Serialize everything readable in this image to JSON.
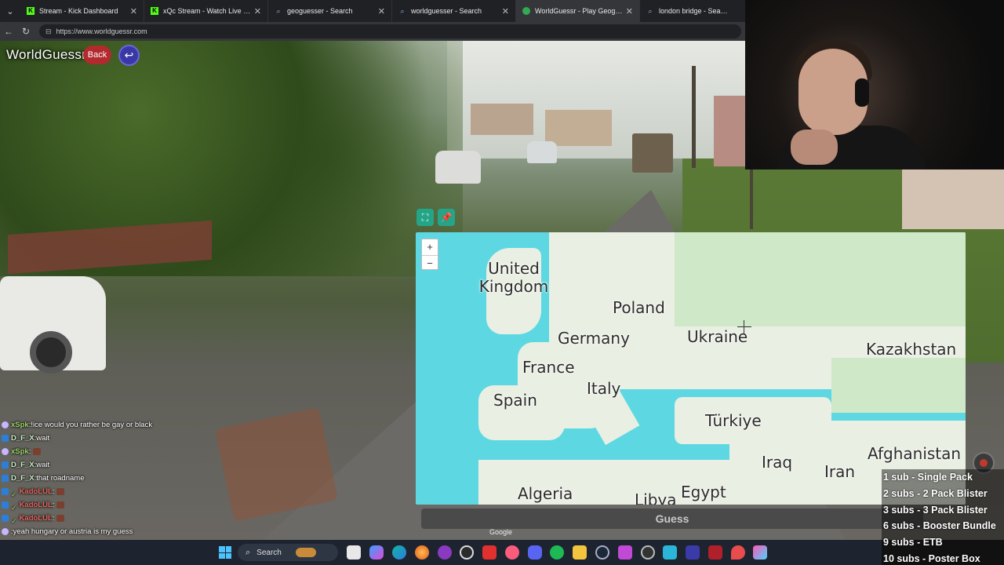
{
  "browser": {
    "tabs": [
      {
        "label": "Stream - Kick Dashboard",
        "icon": "kick-icon",
        "active": false
      },
      {
        "label": "xQc Stream - Watch Live on Kick",
        "icon": "kick-icon",
        "active": false
      },
      {
        "label": "geoguesser - Search",
        "icon": "search-icon",
        "active": false
      },
      {
        "label": "worldguesser - Search",
        "icon": "search-icon",
        "active": false
      },
      {
        "label": "WorldGuessr - Play Geoguessr for",
        "icon": "globe-icon",
        "active": true
      },
      {
        "label": "london bridge - Search",
        "icon": "search-icon",
        "active": false
      }
    ],
    "url": "https://www.worldguessr.com"
  },
  "game": {
    "logo": "WorldGuessr",
    "back_label": "Back",
    "guess_label": "Guess",
    "attribution": "Google"
  },
  "map": {
    "zoom_in": "+",
    "zoom_out": "−",
    "labels": {
      "uk": "United\nKingdom",
      "poland": "Poland",
      "germany": "Germany",
      "ukraine": "Ukraine",
      "kazakhstan": "Kazakhstan",
      "france": "France",
      "italy": "Italy",
      "spain": "Spain",
      "turkiye": "Türkiye",
      "iraq": "Iraq",
      "afghanistan": "Afghanistan",
      "iran": "Iran",
      "algeria": "Algeria",
      "libya": "Libya",
      "egypt": "Egypt"
    }
  },
  "chat": [
    {
      "user": "xSpk",
      "color": "#9dd36a",
      "badge": "purple",
      "text": "!ice would you rather be gay or black",
      "emote": false
    },
    {
      "user": "D_F_X",
      "color": "#c8f0c8",
      "badge": "blue",
      "text": "wait",
      "emote": false
    },
    {
      "user": "xSpk",
      "color": "#9dd36a",
      "badge": "purple",
      "text": "",
      "emote": true
    },
    {
      "user": "D_F_X",
      "color": "#c8f0c8",
      "badge": "blue",
      "text": "wait",
      "emote": false
    },
    {
      "user": "D_F_X",
      "color": "#c8f0c8",
      "badge": "blue",
      "text": "that roadname",
      "emote": false
    },
    {
      "user": "KadoLUL",
      "color": "#e8675f",
      "badge": "blue",
      "text": "",
      "emote": true
    },
    {
      "user": "KadoLUL",
      "color": "#e8675f",
      "badge": "blue",
      "text": "",
      "emote": true
    },
    {
      "user": "KadoLUL",
      "color": "#e8675f",
      "badge": "blue",
      "text": "",
      "emote": true
    },
    {
      "user": "",
      "color": "#e8675f",
      "badge": "purple",
      "text": "yeah hungary or austria is my guess",
      "emote": false
    }
  ],
  "subs": [
    "1 sub - Single Pack",
    "2 subs - 2 Pack Blister",
    "3 subs - 3 Pack Blister",
    "6 subs - Booster Bundle",
    "9 subs - ETB",
    "10 subs - Poster Box"
  ],
  "taskbar": {
    "search_label": "Search"
  }
}
